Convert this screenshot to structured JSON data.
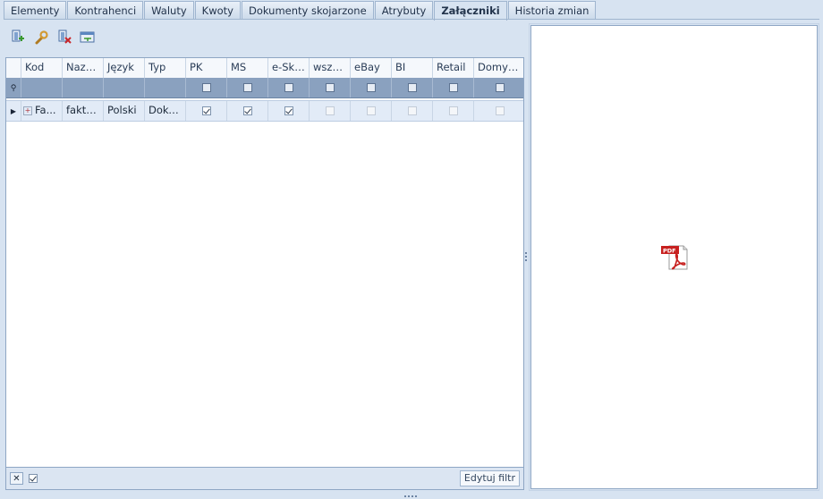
{
  "tabs": [
    {
      "label": "Elementy",
      "active": false
    },
    {
      "label": "Kontrahenci",
      "active": false
    },
    {
      "label": "Waluty",
      "active": false
    },
    {
      "label": "Kwoty",
      "active": false
    },
    {
      "label": "Dokumenty skojarzone",
      "active": false
    },
    {
      "label": "Atrybuty",
      "active": false
    },
    {
      "label": "Załączniki",
      "active": true
    },
    {
      "label": "Historia zmian",
      "active": false
    }
  ],
  "toolbar": {
    "icons": [
      "add-attachment-icon",
      "edit-wrench-icon",
      "delete-attachment-icon",
      "refresh-view-icon"
    ]
  },
  "grid": {
    "columns": [
      "Kod",
      "Nazwa",
      "Język",
      "Typ",
      "PK",
      "MS",
      "e-Sklep",
      "wszys...",
      "eBay",
      "BI",
      "Retail",
      "Domyślny"
    ],
    "rows": [
      {
        "kod": "Fa...",
        "nazwa": "faktura",
        "jezyk": "Polski",
        "typ": "Doku...",
        "checks": [
          true,
          true,
          true,
          false,
          false,
          false,
          false,
          false
        ],
        "enabled": [
          true,
          true,
          true,
          false,
          false,
          false,
          false,
          false
        ]
      }
    ]
  },
  "footer": {
    "filter_enabled": true,
    "edit_filter_label": "Edytuj filtr"
  },
  "preview": {
    "file_icon": "pdf-file-icon",
    "file_label": "PDF"
  },
  "colors": {
    "accent": "#8aa1bf",
    "pdf_red": "#c7201f"
  }
}
